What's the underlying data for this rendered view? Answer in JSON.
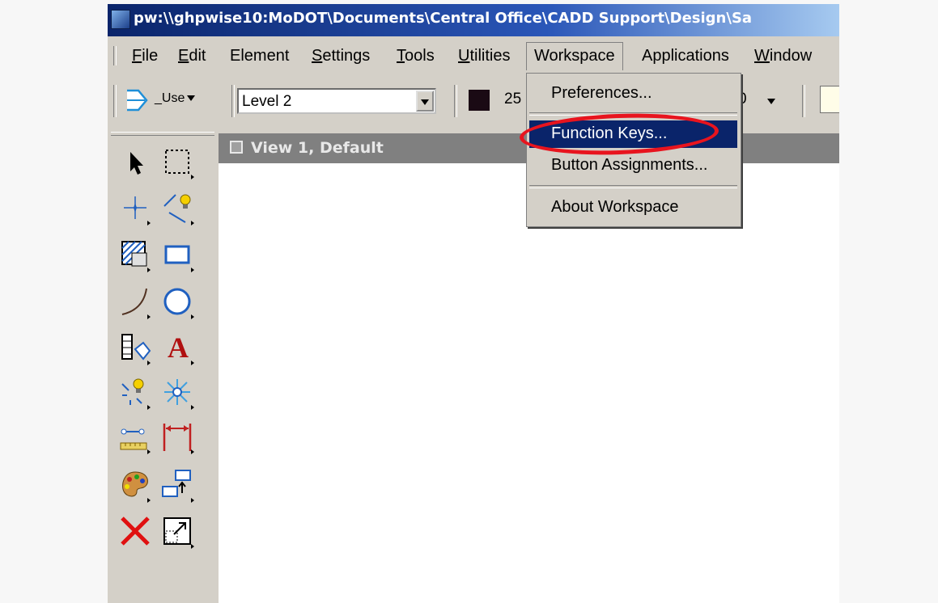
{
  "window": {
    "title": "pw:\\\\ghpwise10:MoDOT\\Documents\\Central Office\\CADD Support\\Design\\Sa"
  },
  "menubar": {
    "items": [
      {
        "key": "F",
        "rest": "ile"
      },
      {
        "key": "E",
        "rest": "dit"
      },
      {
        "key": "",
        "rest": "Element"
      },
      {
        "key": "S",
        "rest": "ettings"
      },
      {
        "key": "T",
        "rest": "ools"
      },
      {
        "key": "U",
        "rest": "tilities"
      },
      {
        "key": "",
        "rest": "Workspace"
      },
      {
        "key": "",
        "rest": "Applications"
      },
      {
        "key": "W",
        "rest": "indow"
      }
    ]
  },
  "toolbar": {
    "user_dropdown": "_Use",
    "level": "Level 2",
    "color_value": "25",
    "weight_value": "0",
    "swatch_color": "#1a0a14"
  },
  "view": {
    "title": "View 1, Default"
  },
  "workspace_menu": {
    "items": [
      "Preferences...",
      "Function Keys...",
      "Button Assignments...",
      "About Workspace"
    ],
    "selected": "Function Keys..."
  },
  "colors": {
    "titlebar": "#0a246a",
    "selection": "#0a246a",
    "highlight_ring": "#e8141e",
    "chrome": "#d4d0c8"
  },
  "tools": [
    {
      "name": "select-element-icon"
    },
    {
      "name": "fence-icon"
    },
    {
      "name": "accudraw-icon"
    },
    {
      "name": "smartline-icon"
    },
    {
      "name": "patterning-icon"
    },
    {
      "name": "rectangle-icon"
    },
    {
      "name": "arc-icon"
    },
    {
      "name": "circle-icon"
    },
    {
      "name": "cell-icon"
    },
    {
      "name": "text-icon"
    },
    {
      "name": "point-icon"
    },
    {
      "name": "snap-icon"
    },
    {
      "name": "measure-icon"
    },
    {
      "name": "dimension-icon"
    },
    {
      "name": "palette-icon"
    },
    {
      "name": "move-icon"
    },
    {
      "name": "delete-icon"
    },
    {
      "name": "scale-icon"
    }
  ]
}
